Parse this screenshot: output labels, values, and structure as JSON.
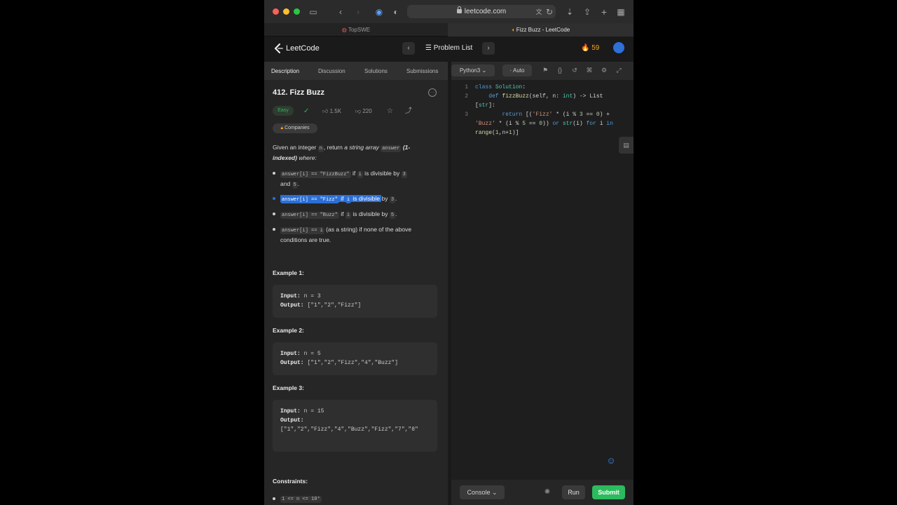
{
  "browser": {
    "url": "leetcode.com",
    "tabs": [
      {
        "label": "TopSWE"
      },
      {
        "label": "Fizz Buzz - LeetCode"
      }
    ]
  },
  "header": {
    "logo": "LeetCode",
    "problem_list": "Problem List",
    "streak": "59"
  },
  "left_tabs": [
    "Description",
    "Discussion",
    "Solutions",
    "Submissions"
  ],
  "problem": {
    "title": "412. Fizz Buzz",
    "difficulty": "Easy",
    "likes": "1.5K",
    "dislikes": "220",
    "companies": "Companies",
    "intro": {
      "p1": "Given an integer ",
      "n": "n",
      "p2": ", return ",
      "em": "a string array",
      "answer": "answer",
      "b1": "(1-",
      "b2": "indexed)",
      "p3": " where:"
    },
    "bullets": {
      "b1_code1": "answer[i] == \"FizzBuzz\"",
      "b1_t1": " if ",
      "b1_code2": "i",
      "b1_t2": " is divisible by ",
      "b1_code3": "3",
      "b1_t3": "and ",
      "b1_code4": "5",
      "b1_t4": ".",
      "b2_code1": "answer[i] == \"Fizz\"",
      "b2_t1": " if ",
      "b2_code2": "i",
      "b2_t2": " is divisible ",
      "b2_t3": "by ",
      "b2_code3": "3",
      "b2_t4": ".",
      "b3_code1": "answer[i] == \"Buzz\"",
      "b3_t1": " if ",
      "b3_code2": "i",
      "b3_t2": " is divisible by ",
      "b3_code3": "5",
      "b3_t3": ".",
      "b4_code1": "answer[i] == i",
      "b4_t1": " (as a string) if none of the above",
      "b4_t2": "conditions are true."
    },
    "examples": [
      {
        "heading": "Example 1:",
        "input_label": "Input:",
        "input": " n = 3",
        "output_label": "Output:",
        "output": " [\"1\",\"2\",\"Fizz\"]"
      },
      {
        "heading": "Example 2:",
        "input_label": "Input:",
        "input": " n = 5",
        "output_label": "Output:",
        "output": " [\"1\",\"2\",\"Fizz\",\"4\",\"Buzz\"]"
      },
      {
        "heading": "Example 3:",
        "input_label": "Input:",
        "input": " n = 15",
        "output_label": "Output:",
        "output": "[\"1\",\"2\",\"Fizz\",\"4\",\"Buzz\",\"Fizz\",\"7\",\"8\""
      }
    ],
    "constraints_heading": "Constraints:",
    "constraint_1": "1 <= n <= 10⁴"
  },
  "editor": {
    "language": "Python3",
    "mode": "Auto",
    "line_numbers": [
      "1",
      "2",
      "3"
    ]
  },
  "bottom": {
    "console": "Console",
    "run": "Run",
    "submit": "Submit"
  },
  "colors": {
    "accent_green": "#2cbb5d",
    "streak_orange": "#ffa116",
    "selection_blue": "#2b6fd6"
  }
}
